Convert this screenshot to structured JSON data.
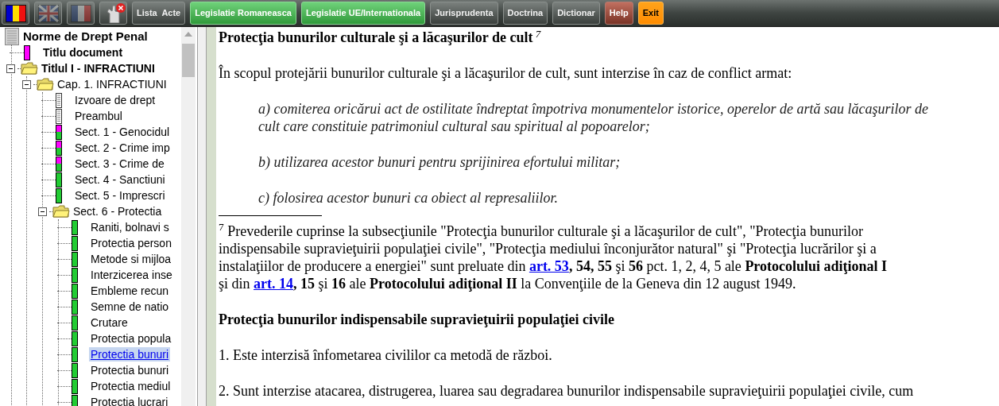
{
  "toolbar": {
    "languages": [
      {
        "kind": "ro",
        "selected": true
      },
      {
        "kind": "uk",
        "selected": false
      },
      {
        "kind": "fr",
        "selected": false
      }
    ],
    "print_button": {
      "disabled": true
    },
    "buttons": [
      {
        "label": "Lista  Acte",
        "kind": "dark"
      },
      {
        "label": "Legislatie Romaneasca",
        "kind": "green"
      },
      {
        "label": "Legislatie UE/Internationala",
        "kind": "green"
      },
      {
        "label": "Jurisprudenta",
        "kind": "dark"
      },
      {
        "label": "Doctrina",
        "kind": "dark"
      },
      {
        "label": "Dictionar",
        "kind": "dark"
      },
      {
        "label": "Help",
        "kind": "red"
      },
      {
        "label": "Exit",
        "kind": "orange"
      }
    ]
  },
  "tree": {
    "label": "Norme de Drept Penal",
    "kind": "root",
    "children": [
      {
        "label": "Titlu document",
        "kind": "pink",
        "selected": false
      },
      {
        "label": "Titlul I - INFRACTIUNI",
        "kind": "folder",
        "expanded": true,
        "children": [
          {
            "label": "Cap. 1. INFRACTIUNI",
            "kind": "folder",
            "expanded": true,
            "children": [
              {
                "label": "Izvoare de drept",
                "kind": "page",
                "selected": false
              },
              {
                "label": "Preambul",
                "kind": "page",
                "selected": false
              },
              {
                "label": "Sect. 1 - Genocidul",
                "kind": "split",
                "selected": false
              },
              {
                "label": "Sect. 2 - Crime imp",
                "kind": "split",
                "selected": false
              },
              {
                "label": "Sect. 3 - Crime de",
                "kind": "split",
                "selected": false
              },
              {
                "label": "Sect. 4 - Sanctiuni",
                "kind": "green",
                "selected": false
              },
              {
                "label": "Sect. 5 - Imprescri",
                "kind": "green",
                "selected": false
              },
              {
                "label": "Sect. 6 - Protectia",
                "kind": "folder",
                "expanded": true,
                "children": [
                  {
                    "label": "Raniti, bolnavi s",
                    "kind": "green",
                    "selected": false
                  },
                  {
                    "label": "Protectia person",
                    "kind": "green",
                    "selected": false
                  },
                  {
                    "label": "Metode si mijloa",
                    "kind": "green",
                    "selected": false
                  },
                  {
                    "label": "Interzicerea inse",
                    "kind": "green",
                    "selected": false
                  },
                  {
                    "label": "Embleme recun",
                    "kind": "green",
                    "selected": false
                  },
                  {
                    "label": "Semne de natio",
                    "kind": "green",
                    "selected": false
                  },
                  {
                    "label": "Crutare",
                    "kind": "green",
                    "selected": false
                  },
                  {
                    "label": "Protectia popula",
                    "kind": "green",
                    "selected": false
                  },
                  {
                    "label": "Protectia bunuri",
                    "kind": "green",
                    "selected": true
                  },
                  {
                    "label": "Protectia bunuri",
                    "kind": "green",
                    "selected": false
                  },
                  {
                    "label": "Protectia mediul",
                    "kind": "green",
                    "selected": false
                  },
                  {
                    "label": "Protectia lucrari",
                    "kind": "green",
                    "selected": false
                  }
                ]
              }
            ]
          }
        ]
      }
    ]
  },
  "document": {
    "blocks": [
      {
        "kind": "heading",
        "text": "Protecţia bunurilor culturale şi a lăcaşurilor de cult",
        "note_mark": "7"
      },
      {
        "kind": "paragraph",
        "text": "În scopul protejării bunurilor culturale şi a lăcaşurilor de cult, sunt interzise în caz de conflict armat:"
      },
      {
        "kind": "item",
        "text": "a) comiterea oricărui act de ostilitate îndreptat împotriva monumentelor istorice, operelor de artă sau lăcaşurilor de cult care constituie patrimoniul cultural sau spiritual al popoarelor;"
      },
      {
        "kind": "item",
        "text": "b) utilizarea acestor bunuri pentru sprijinirea efortului militar;"
      },
      {
        "kind": "item",
        "text": "c) folosirea acestor bunuri ca obiect al represaliilor."
      },
      {
        "kind": "footnote",
        "parts": [
          {
            "kind": "text",
            "text": "$^{7}$ Prevederile cuprinse la subsecţiunile \"Protecţia bunurilor culturale şi a lăcaşurilor de cult\", \"Protecţia bunurilor indispensabile supravieţuirii populaţiei civile\", \"Protecţia mediului înconjurător natural\" şi \"Protecţia lucrărilor şi a instalaţiilor de producere a energiei\" sunt preluate din "
          },
          {
            "kind": "link",
            "text": "art. 53"
          },
          {
            "kind": "text",
            "text": "**, 54, 55** şi **56** pct. 1, 2, 4, 5 ale **Protocolului adiţional I** şi din "
          },
          {
            "kind": "link",
            "text": "art. 14"
          },
          {
            "kind": "text",
            "text": "**, 15**  şi **16** ale **Protocolului adiţional II** la Convenţiile de la Geneva din 12 august 1949."
          }
        ]
      },
      {
        "kind": "heading",
        "text": "Protecţia bunurilor indispensabile supravieţuirii populaţiei civile"
      },
      {
        "kind": "paragraph",
        "text": "1. Este interzisă înfometarea civililor ca metodă de război."
      },
      {
        "kind": "paragraph",
        "text": "2. Sunt interzise atacarea, distrugerea, luarea sau degradarea bunurilor indispensabile supravieţuirii populaţiei civile, cum"
      }
    ]
  }
}
